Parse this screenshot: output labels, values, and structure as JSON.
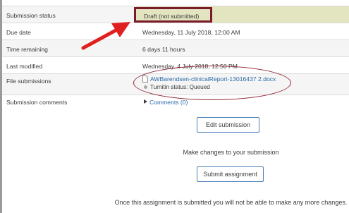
{
  "rows": {
    "submission_status": {
      "label": "Submission status",
      "value": "Draft (not submitted)"
    },
    "due_date": {
      "label": "Due date",
      "value": "Wednesday, 11 July 2018, 12:00 AM"
    },
    "time_remaining": {
      "label": "Time remaining",
      "value": "6 days 11 hours"
    },
    "last_modified": {
      "label": "Last modified",
      "value": "Wednesday, 4 July 2018, 12:50 PM"
    },
    "file_submissions": {
      "label": "File submissions",
      "file_name": "AWBarendsen-clinicalReport-13016437 2.docx",
      "turnitin_status": "Turnitin status: Queued"
    },
    "submission_comments": {
      "label": "Submission comments",
      "link": "Comments (0)"
    }
  },
  "actions": {
    "edit_label": "Edit submission",
    "make_changes_text": "Make changes to your submission",
    "submit_label": "Submit assignment",
    "submit_warning": "Once this assignment is submitted you will not be able to make any more changes."
  },
  "colors": {
    "highlight_box": "#7a1b2a",
    "status_background": "#e3e5c0",
    "annotation_arrow": "#e02020",
    "oval": "#8d2535",
    "link": "#2a6aa8"
  },
  "icons": {
    "file": "document-icon",
    "turnitin": "status-dot-icon",
    "comments": "caret-right-icon",
    "annotation": "red-arrow-icon"
  }
}
